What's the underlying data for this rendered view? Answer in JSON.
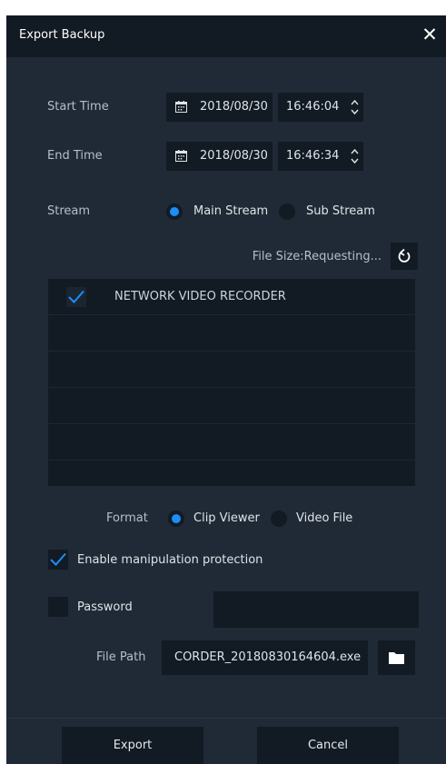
{
  "dialog": {
    "title": "Export Backup",
    "close_icon": "close-icon"
  },
  "start_time": {
    "label": "Start Time",
    "date": "2018/08/30",
    "time": "16:46:04"
  },
  "end_time": {
    "label": "End Time",
    "date": "2018/08/30",
    "time": "16:46:34"
  },
  "stream": {
    "label": "Stream",
    "options": [
      "Main Stream",
      "Sub Stream"
    ],
    "selected": "Main Stream"
  },
  "file_size": {
    "text": "File Size:Requesting..."
  },
  "device_list": {
    "items": [
      {
        "name": "NETWORK VIDEO RECORDER",
        "checked": true
      }
    ]
  },
  "format": {
    "label": "Format",
    "options": [
      "Clip Viewer",
      "Video File"
    ],
    "selected": "Clip Viewer"
  },
  "manipulation": {
    "label": "Enable manipulation protection",
    "checked": true
  },
  "password": {
    "label": "Password",
    "checked": false,
    "value": ""
  },
  "file_path": {
    "label": "File Path",
    "value": "CORDER_20180830164604.exe"
  },
  "buttons": {
    "export": "Export",
    "cancel": "Cancel"
  },
  "colors": {
    "accent": "#1c8ef7",
    "panel": "#1f2a36",
    "field": "#121a23"
  }
}
